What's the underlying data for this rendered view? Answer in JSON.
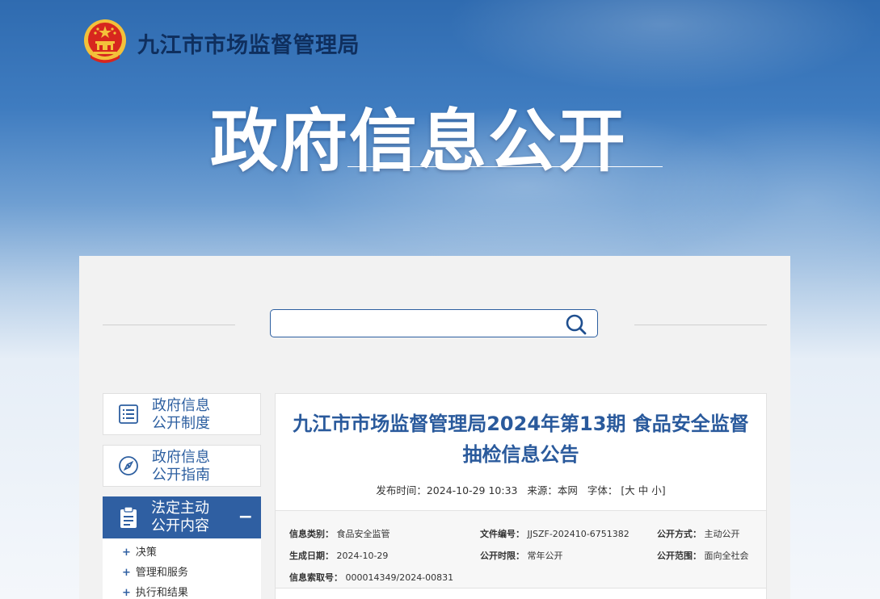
{
  "header": {
    "org_name": "九江市市场监督管理局",
    "hero_title": "政府信息公开"
  },
  "search": {
    "value": "",
    "placeholder": ""
  },
  "sidebar": {
    "items": [
      {
        "label": "政府信息公开制度",
        "line1": "政府信息",
        "line2": "公开制度",
        "icon": "document-list-icon"
      },
      {
        "label": "政府信息公开指南",
        "line1": "政府信息",
        "line2": "公开指南",
        "icon": "compass-icon"
      }
    ],
    "active": {
      "line1": "法定主动",
      "line2": "公开内容",
      "icon": "clipboard-icon",
      "toggle": "−"
    },
    "submenu": [
      "决策",
      "管理和服务",
      "执行和结果"
    ]
  },
  "article": {
    "title_line1": "九江市市场监督管理局2024年第13期 食品安全监督",
    "title_line2": "抽检信息公告",
    "publish_label": "发布时间：",
    "publish_time": "2024-10-29 10:33",
    "source_label": "来源：",
    "source": "本网",
    "font_label": "字体：",
    "font_open": "[",
    "font_large": "大",
    "font_medium": "中",
    "font_small": "小",
    "font_close": "]"
  },
  "info": {
    "category_label": "信息类别：",
    "category": "食品安全监管",
    "file_no_label": "文件编号：",
    "file_no": "JJSZF-202410-6751382",
    "method_label": "公开方式：",
    "method": "主动公开",
    "date_label": "生成日期：",
    "date": "2024-10-29",
    "period_label": "公开时限：",
    "period": "常年公开",
    "scope_label": "公开范围：",
    "scope": "面向全社会",
    "index_label": "信息索取号：",
    "index": "000014349/2024-00831"
  },
  "colors": {
    "primary": "#2f5fa2",
    "title_blue": "#2a5a9c",
    "emblem_red": "#d7261e",
    "emblem_gold": "#f3c13a"
  }
}
